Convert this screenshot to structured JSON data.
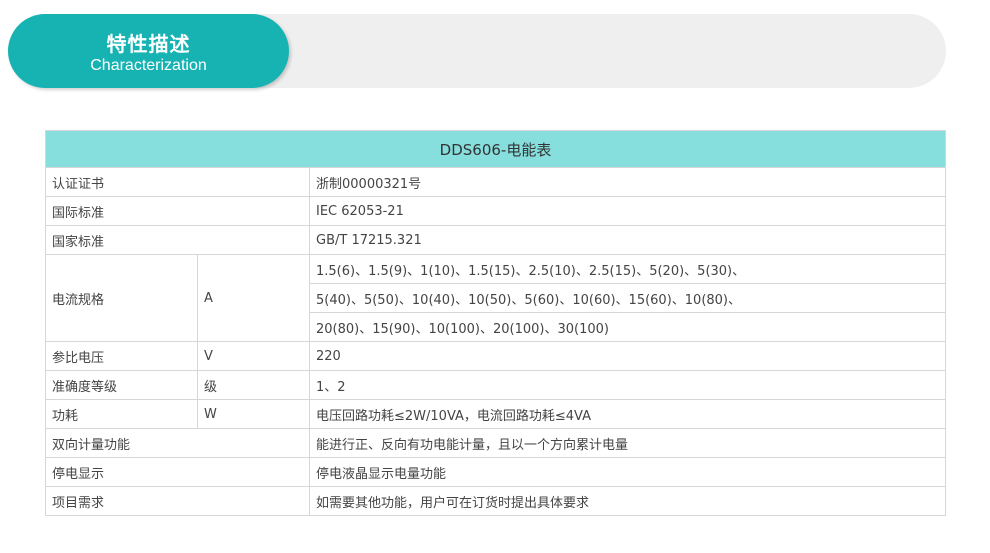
{
  "banner": {
    "title_cn": "特性描述",
    "title_en": "Characterization"
  },
  "table": {
    "title": "DDS606-电能表",
    "rows": {
      "cert": {
        "label": "认证证书",
        "value": "浙制00000321号"
      },
      "intl_std": {
        "label": "国际标准",
        "value": "IEC 62053-21"
      },
      "natl_std": {
        "label": "国家标准",
        "value": "GB/T 17215.321"
      },
      "current": {
        "label": "电流规格",
        "unit": "A",
        "lines": [
          "1.5(6)、1.5(9)、1(10)、1.5(15)、2.5(10)、2.5(15)、5(20)、5(30)、",
          "5(40)、5(50)、10(40)、10(50)、5(60)、10(60)、15(60)、10(80)、",
          "20(80)、15(90)、10(100)、20(100)、30(100)"
        ]
      },
      "voltage": {
        "label": "参比电压",
        "unit": "V",
        "value": "220"
      },
      "accuracy": {
        "label": "准确度等级",
        "unit": "级",
        "value": "1、2"
      },
      "power": {
        "label": "功耗",
        "unit": "W",
        "value": "电压回路功耗≤2W/10VA，电流回路功耗≤4VA"
      },
      "bidir": {
        "label": "双向计量功能",
        "value": "能进行正、反向有功电能计量，且以一个方向累计电量"
      },
      "outage": {
        "label": "停电显示",
        "value": "停电液晶显示电量功能"
      },
      "custom": {
        "label": "项目需求",
        "value": "如需要其他功能，用户可在订货时提出具体要求"
      }
    }
  },
  "colors": {
    "banner_pill": "#17b3b3",
    "banner_track": "#efefef",
    "table_header": "#86dedd",
    "border": "#d7d7d7",
    "text": "#444444"
  }
}
